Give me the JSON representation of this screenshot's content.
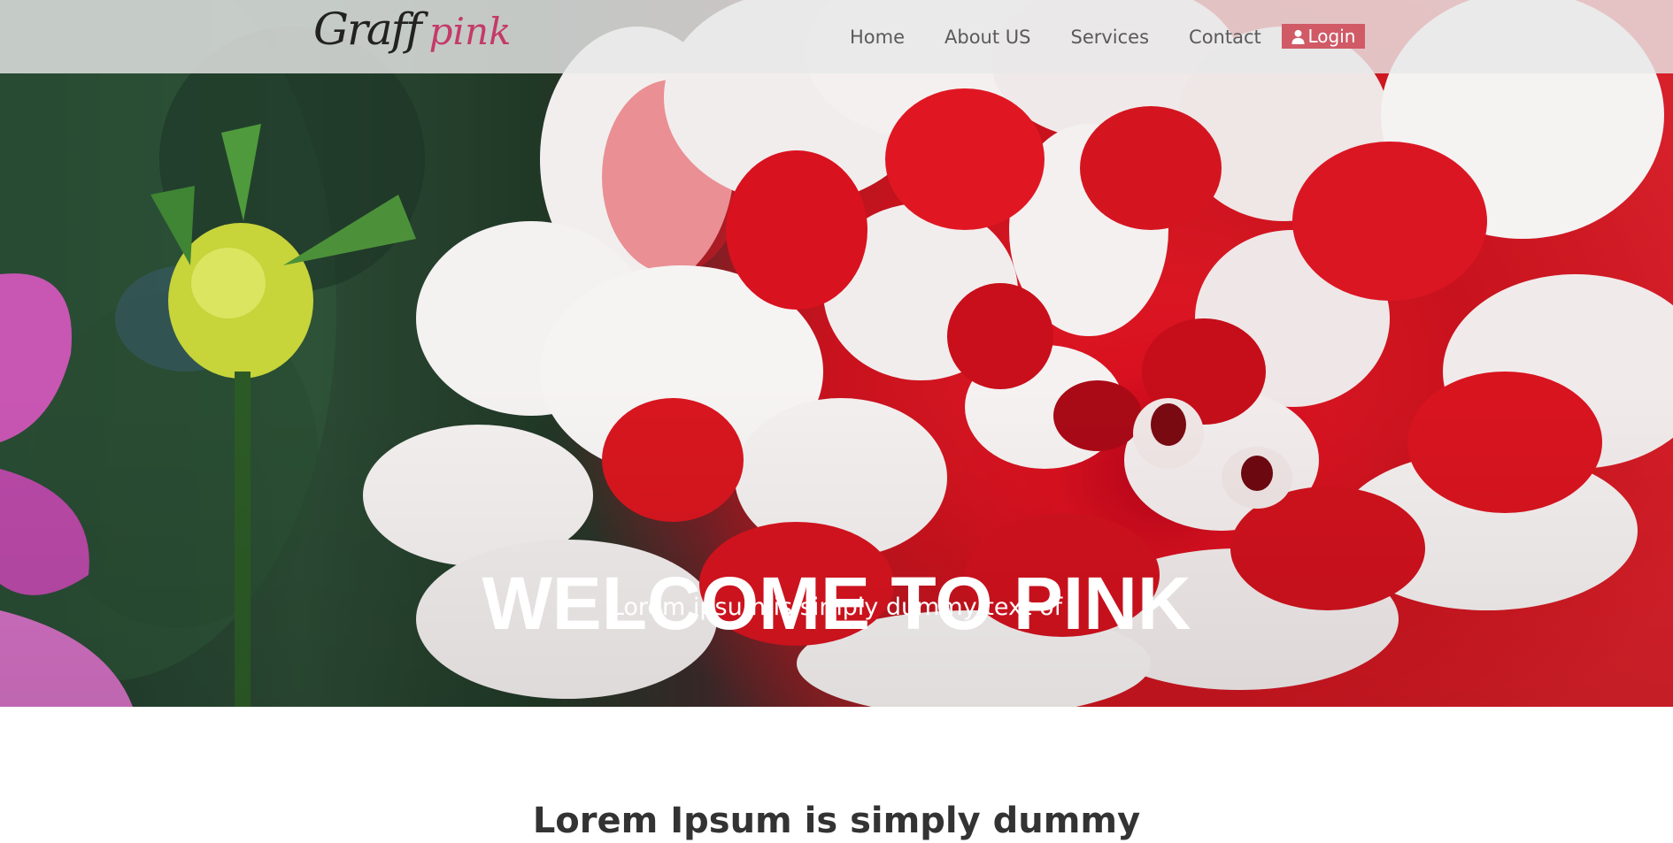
{
  "logo": {
    "part1": "Graff",
    "part2": "pink"
  },
  "nav": {
    "items": [
      {
        "label": "Home"
      },
      {
        "label": "About US"
      },
      {
        "label": "Services"
      },
      {
        "label": "Contact"
      }
    ],
    "login_label": "Login"
  },
  "hero": {
    "title": "WELCOME TO PINK",
    "subtitle": "Lorem ipsum is simply dummy text of"
  },
  "section": {
    "heading": "Lorem Ipsum is simply dummy"
  },
  "colors": {
    "accent": "#d05a66",
    "logo_accent": "#c43a6a",
    "navbar_bg": "#e8e8e8",
    "nav_text": "#5a5a5a"
  }
}
